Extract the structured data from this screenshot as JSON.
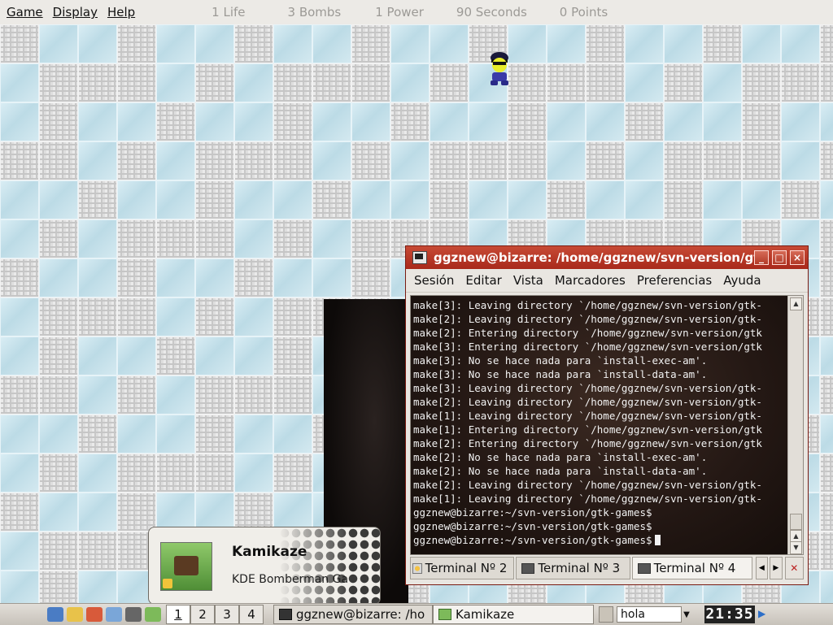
{
  "menubar": {
    "menus": [
      "Game",
      "Display",
      "Help"
    ],
    "stats": {
      "lives": "1 Life",
      "bombs": "3 Bombs",
      "power": "1 Power",
      "seconds": "90 Seconds",
      "points": "0 Points"
    }
  },
  "board": {
    "tile_colors": {
      "ice": "#cbe3ec",
      "stone": "#dedede",
      "brick": "#cfcfcf",
      "dark": "#1a1212"
    }
  },
  "konsole": {
    "title": "ggznew@bizarre: /home/ggznew/svn-version/gt",
    "window_buttons": [
      "_",
      "□",
      "×"
    ],
    "menus": [
      "Sesión",
      "Editar",
      "Vista",
      "Marcadores",
      "Preferencias",
      "Ayuda"
    ],
    "lines": [
      "make[3]: Leaving directory `/home/ggznew/svn-version/gtk-",
      "make[2]: Leaving directory `/home/ggznew/svn-version/gtk-",
      "make[2]: Entering directory `/home/ggznew/svn-version/gtk",
      "make[3]: Entering directory `/home/ggznew/svn-version/gtk",
      "make[3]: No se hace nada para `install-exec-am'.",
      "make[3]: No se hace nada para `install-data-am'.",
      "make[3]: Leaving directory `/home/ggznew/svn-version/gtk-",
      "make[2]: Leaving directory `/home/ggznew/svn-version/gtk-",
      "make[1]: Leaving directory `/home/ggznew/svn-version/gtk-",
      "make[1]: Entering directory `/home/ggznew/svn-version/gtk",
      "make[2]: Entering directory `/home/ggznew/svn-version/gtk",
      "make[2]: No se hace nada para `install-exec-am'.",
      "make[2]: No se hace nada para `install-data-am'.",
      "make[2]: Leaving directory `/home/ggznew/svn-version/gtk-",
      "make[1]: Leaving directory `/home/ggznew/svn-version/gtk-",
      "ggznew@bizarre:~/svn-version/gtk-games$",
      "ggznew@bizarre:~/svn-version/gtk-games$"
    ],
    "prompt": "ggznew@bizarre:~/svn-version/gtk-games$",
    "tabs": [
      "Terminal Nº 2",
      "Terminal Nº 3",
      "Terminal Nº 4"
    ],
    "title_color": "#b0301f"
  },
  "notification": {
    "title": "Kamikaze",
    "subtitle": "KDE Bomberman Ga"
  },
  "taskbar": {
    "pager": [
      "1",
      "2",
      "3",
      "4"
    ],
    "tasks": [
      {
        "label": "ggznew@bizarre: /ho",
        "icon": "terminal-icon"
      },
      {
        "label": "Kamikaze",
        "icon": "kamikaze-icon"
      }
    ],
    "input_value": "hola",
    "clock": "21:35"
  }
}
